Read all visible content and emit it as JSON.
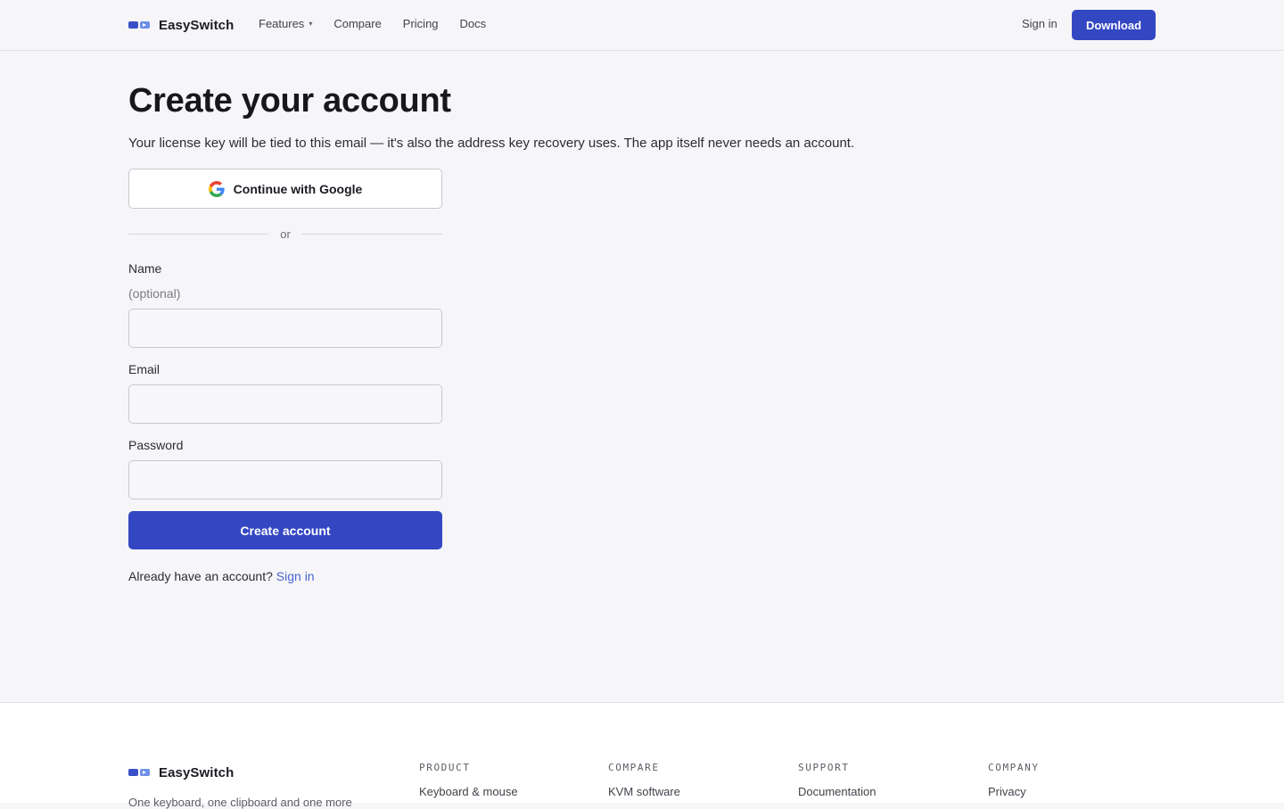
{
  "header": {
    "brand": "EasySwitch",
    "nav": [
      {
        "label": "Features",
        "has_dropdown": true
      },
      {
        "label": "Compare"
      },
      {
        "label": "Pricing"
      },
      {
        "label": "Docs"
      }
    ],
    "caret": "▾",
    "sign_in": "Sign in",
    "download": "Download"
  },
  "main": {
    "title": "Create your account",
    "subtitle": "Your license key will be tied to this email — it's also the address key recovery uses. The app itself never needs an account.",
    "google_button": "Continue with Google",
    "divider": "or",
    "fields": {
      "name_label": "Name",
      "name_hint": "(optional)",
      "name_value": "",
      "email_label": "Email",
      "email_value": "",
      "password_label": "Password",
      "password_value": ""
    },
    "submit": "Create account",
    "already_text": "Already have an account?",
    "already_link": "Sign in"
  },
  "footer": {
    "brand": "EasySwitch",
    "tagline": "One keyboard, one clipboard and one more",
    "columns": [
      {
        "heading": "PRODUCT",
        "first_link": "Keyboard & mouse"
      },
      {
        "heading": "COMPARE",
        "first_link": "KVM software"
      },
      {
        "heading": "SUPPORT",
        "first_link": "Documentation"
      },
      {
        "heading": "COMPANY",
        "first_link": "Privacy"
      }
    ]
  },
  "colors": {
    "accent": "#3347c3",
    "link": "#4a63d2",
    "background": "#f6f6f8"
  },
  "icons": [
    "easyswitch-logo-icon",
    "chevron-down-icon",
    "google-icon"
  ]
}
